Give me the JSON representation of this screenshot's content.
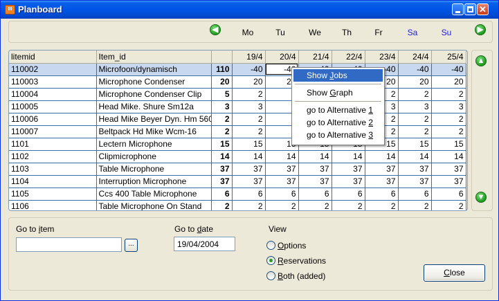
{
  "window": {
    "title": "Planboard",
    "icon": "app-icon"
  },
  "days": [
    {
      "label": "Mo",
      "weekend": false
    },
    {
      "label": "Tu",
      "weekend": false
    },
    {
      "label": "We",
      "weekend": false
    },
    {
      "label": "Th",
      "weekend": false
    },
    {
      "label": "Fr",
      "weekend": false
    },
    {
      "label": "Sa",
      "weekend": true
    },
    {
      "label": "Su",
      "weekend": true
    }
  ],
  "grid": {
    "columns": [
      "litemid",
      "Item_id",
      "",
      "19/4",
      "20/4",
      "21/4",
      "22/4",
      "23/4",
      "24/4",
      "25/4"
    ],
    "rows": [
      {
        "id": "110002",
        "name": "Microfoon/dynamisch",
        "total": "110",
        "vals": [
          "-40",
          "-40",
          "-40",
          "-40",
          "-40",
          "-40",
          "-40"
        ]
      },
      {
        "id": "110003",
        "name": "Microphone Condenser",
        "total": "20",
        "vals": [
          "20",
          "20",
          "20",
          "20",
          "20",
          "20",
          "20"
        ]
      },
      {
        "id": "110004",
        "name": "Microphone Condenser Clip",
        "total": "5",
        "vals": [
          "2",
          "2",
          "2",
          "2",
          "2",
          "2",
          "2"
        ]
      },
      {
        "id": "110005",
        "name": "Head Mike. Shure Sm12a",
        "total": "3",
        "vals": [
          "3",
          "3",
          "3",
          "3",
          "3",
          "3",
          "3"
        ]
      },
      {
        "id": "110006",
        "name": "Head Mike Beyer Dyn. Hm 560",
        "total": "2",
        "vals": [
          "2",
          "2",
          "2",
          "2",
          "2",
          "2",
          "2"
        ]
      },
      {
        "id": "110007",
        "name": "Beltpack Hd Mike Wcm-16",
        "total": "2",
        "vals": [
          "2",
          "2",
          "2",
          "2",
          "2",
          "2",
          "2"
        ]
      },
      {
        "id": "1101",
        "name": "Lectern Microphone",
        "total": "15",
        "vals": [
          "15",
          "15",
          "15",
          "15",
          "15",
          "15",
          "15"
        ]
      },
      {
        "id": "1102",
        "name": "Clipmicrophone",
        "total": "14",
        "vals": [
          "14",
          "14",
          "14",
          "14",
          "14",
          "14",
          "14"
        ]
      },
      {
        "id": "1103",
        "name": "Table Microphone",
        "total": "37",
        "vals": [
          "37",
          "37",
          "37",
          "37",
          "37",
          "37",
          "37"
        ]
      },
      {
        "id": "1104",
        "name": "Interruption Microphone",
        "total": "37",
        "vals": [
          "37",
          "37",
          "37",
          "37",
          "37",
          "37",
          "37"
        ]
      },
      {
        "id": "1105",
        "name": "Ccs 400 Table Microphone",
        "total": "6",
        "vals": [
          "6",
          "6",
          "6",
          "6",
          "6",
          "6",
          "6"
        ]
      },
      {
        "id": "1106",
        "name": "Table Microphone On Stand",
        "total": "2",
        "vals": [
          "2",
          "2",
          "2",
          "2",
          "2",
          "2",
          "2"
        ]
      }
    ]
  },
  "context_menu": {
    "show_jobs": {
      "pre": "Show ",
      "key": "J",
      "post": "obs"
    },
    "show_graph": {
      "pre": "Show ",
      "key": "G",
      "post": "raph"
    },
    "alt1": {
      "pre": "go to Alternative ",
      "key": "1",
      "post": ""
    },
    "alt2": {
      "pre": "go to Alternative ",
      "key": "2",
      "post": ""
    },
    "alt3": {
      "pre": "go to Alternative ",
      "key": "3",
      "post": ""
    }
  },
  "goto_item": {
    "pre": "Go to ",
    "key": "i",
    "post": "tem",
    "value": "",
    "browse_label": "..."
  },
  "goto_date": {
    "pre": "Go to ",
    "key": "d",
    "post": "ate",
    "value": "19/04/2004"
  },
  "view": {
    "label": "View",
    "options": {
      "pre": "",
      "key": "O",
      "post": "ptions"
    },
    "reservations": {
      "pre": "",
      "key": "R",
      "post": "eservations"
    },
    "both": {
      "pre": "",
      "key": "B",
      "post": "oth (added)"
    }
  },
  "close": {
    "pre": "",
    "key": "C",
    "post": "lose"
  }
}
